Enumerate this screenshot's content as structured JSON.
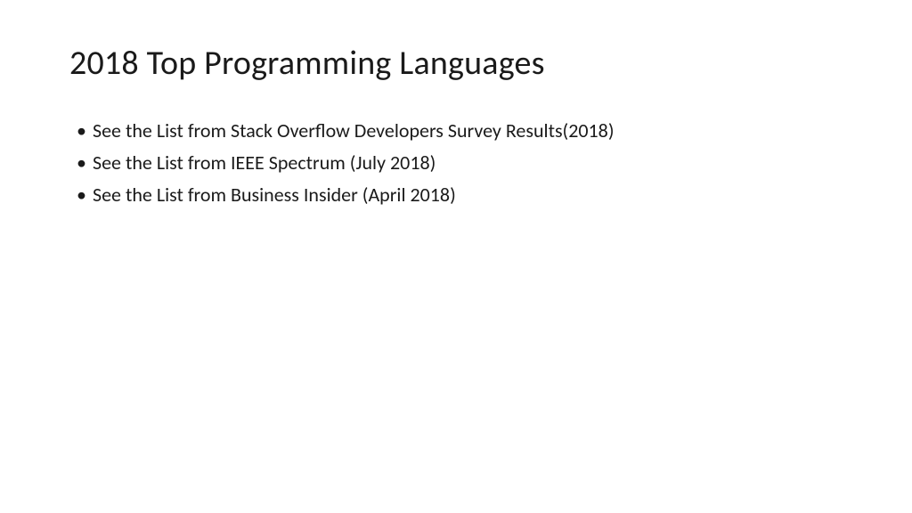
{
  "slide": {
    "title": "2018 Top Programming Languages",
    "bullets": [
      "See the List from Stack Overflow Developers Survey Results(2018)",
      "See the List from IEEE Spectrum (July 2018)",
      "See the List from Business Insider (April 2018)"
    ]
  }
}
